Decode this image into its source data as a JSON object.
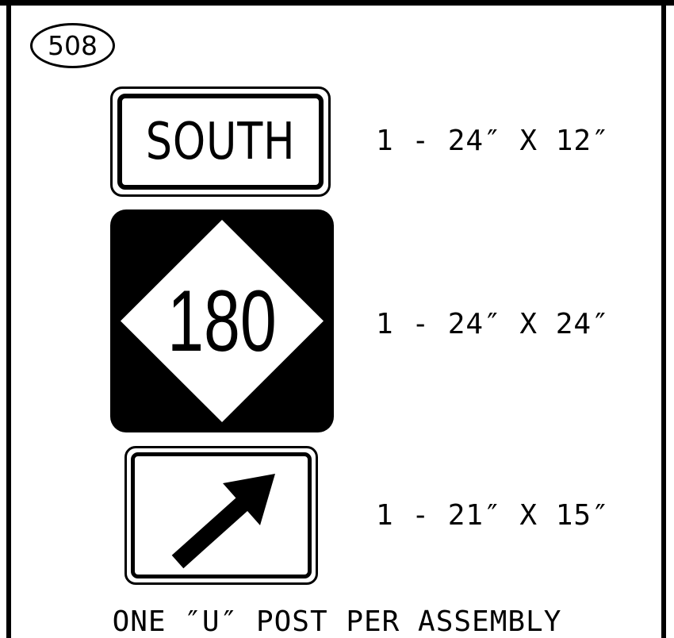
{
  "assembly": {
    "id": "508"
  },
  "signs": {
    "south": {
      "legend": "SOUTH",
      "size": "1 - 24″ X 12″"
    },
    "route": {
      "number": "180",
      "size": "1 - 24″ X 24″"
    },
    "arrow": {
      "icon": "arrow-up-right-icon",
      "size": "1 - 21″ X 15″"
    }
  },
  "footer": {
    "note": "ONE ″U″ POST PER ASSEMBLY"
  },
  "colors": {
    "ink": "#000000",
    "background": "#ffffff"
  }
}
